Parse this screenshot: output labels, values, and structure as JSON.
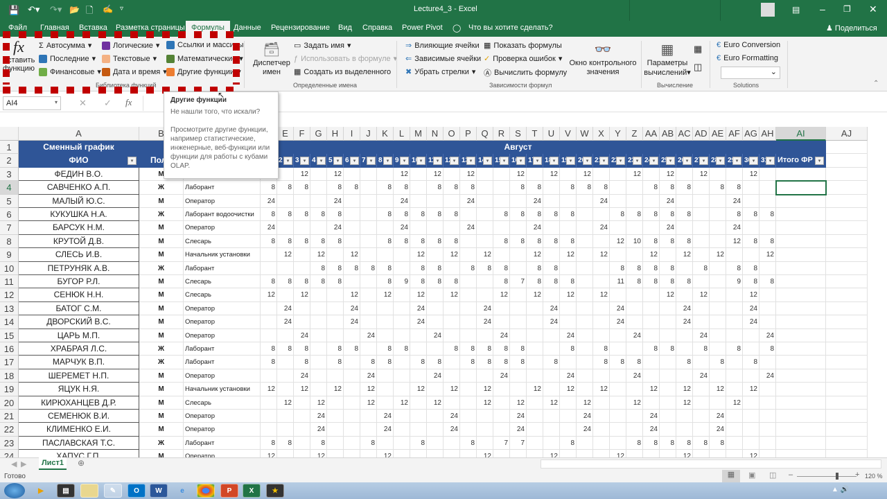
{
  "window": {
    "title": "Lecture4_3  -  Excel",
    "share": "Поделиться",
    "tell_me": "Что вы хотите сделать?"
  },
  "tabs": [
    "Файл",
    "Главная",
    "Вставка",
    "Разметка страницы",
    "Формулы",
    "Данные",
    "Рецензирование",
    "Вид",
    "Справка",
    "Power Pivot"
  ],
  "active_tab": "Формулы",
  "ribbon": {
    "insert_function": [
      "Вставить",
      "функцию"
    ],
    "library": {
      "items": [
        "Автосумма",
        "Последние",
        "Финансовые",
        "Логические",
        "Текстовые",
        "Дата и время",
        "Ссылки и массивы",
        "Математические",
        "Другие функции"
      ],
      "label": "Библиотека функций"
    },
    "names": {
      "manager": [
        "Диспетчер",
        "имен"
      ],
      "define": "Задать имя",
      "use": "Использовать в формуле",
      "create": "Создать из выделенного",
      "label": "Определенные имена"
    },
    "audit": {
      "items": [
        "Влияющие ячейки",
        "Зависимые ячейки",
        "Убрать стрелки",
        "Показать формулы",
        "Проверка ошибок",
        "Вычислить формулу"
      ],
      "label": "Зависимости формул"
    },
    "watch": [
      "Окно контрольного",
      "значения"
    ],
    "calc": {
      "options": [
        "Параметры",
        "вычислений"
      ],
      "label": "Вычисление"
    },
    "solutions": {
      "items": [
        "Euro Conversion",
        "Euro Formatting"
      ],
      "label": "Solutions"
    }
  },
  "tooltip": {
    "title": "Другие функции",
    "subtitle": "Не нашли того, что искали?",
    "body": "Просмотрите другие функции, например статистические, инженерные, веб-функции или функции для работы с кубами OLAP."
  },
  "namebox": "AI4",
  "columns": [
    "A",
    "B",
    "C",
    "D",
    "E",
    "F",
    "G",
    "H",
    "I",
    "J",
    "K",
    "L",
    "M",
    "N",
    "O",
    "P",
    "Q",
    "R",
    "S",
    "T",
    "U",
    "V",
    "W",
    "X",
    "Y",
    "Z",
    "AA",
    "AB",
    "AC",
    "AD",
    "AE",
    "AF",
    "AG",
    "AH",
    "AI",
    "AJ"
  ],
  "sheet": {
    "title": "Сменный график",
    "month": "Август",
    "h_name": "ФИО",
    "h_gender": "Пол",
    "h_total": "Итого ФР",
    "days": [
      "1",
      "2",
      "3",
      "4",
      "5",
      "6",
      "7",
      "8",
      "9",
      "10",
      "11",
      "12",
      "13",
      "14",
      "15",
      "16",
      "17",
      "18",
      "19",
      "20",
      "21",
      "22",
      "23",
      "24",
      "25",
      "26",
      "27",
      "28",
      "29",
      "30",
      "31"
    ],
    "selected": "AI4",
    "rows": [
      {
        "n": "ФЕДИН В.О.",
        "g": "М",
        "p": "Начальник установки",
        "h": {
          "D": 12,
          "F": 12,
          "H": 12,
          "L": 12,
          "N": 12,
          "P": 12,
          "S": 12,
          "U": 12,
          "W": 12,
          "Z": 12,
          "AB": 12,
          "AD": 12,
          "AG": 12
        }
      },
      {
        "n": "САВЧЕНКО А.П.",
        "g": "Ж",
        "p": "Лаборант",
        "h": {
          "D": 8,
          "E": 8,
          "F": 8,
          "H": 8,
          "I": 8,
          "K": 8,
          "L": 8,
          "N": 8,
          "O": 8,
          "P": 8,
          "S": 8,
          "T": 8,
          "V": 8,
          "W": 8,
          "X": 8,
          "AA": 8,
          "AB": 8,
          "AC": 8,
          "AE": 8,
          "AF": 8
        }
      },
      {
        "n": "МАЛЫЙ Ю.С.",
        "g": "М",
        "p": "Оператор",
        "h": {
          "D": 24,
          "H": 24,
          "L": 24,
          "P": 24,
          "T": 24,
          "X": 24,
          "AB": 24,
          "AF": 24
        }
      },
      {
        "n": "КУКУШКА Н.А.",
        "g": "Ж",
        "p": "Лаборант водоочистки",
        "h": {
          "D": 8,
          "E": 8,
          "F": 8,
          "G": 8,
          "H": 8,
          "K": 8,
          "L": 8,
          "M": 8,
          "N": 8,
          "O": 8,
          "R": 8,
          "S": 8,
          "T": 8,
          "U": 8,
          "V": 8,
          "Y": 8,
          "Z": 8,
          "AA": 8,
          "AB": 8,
          "AC": 8,
          "AF": 8,
          "AG": 8,
          "AH": 8
        }
      },
      {
        "n": "БАРСУК Н.М.",
        "g": "М",
        "p": "Оператор",
        "h": {
          "D": 24,
          "H": 24,
          "L": 24,
          "P": 24,
          "T": 24,
          "X": 24,
          "AB": 24,
          "AF": 24
        }
      },
      {
        "n": "КРУТОЙ Д.В.",
        "g": "М",
        "p": "Слесарь",
        "h": {
          "D": 8,
          "E": 8,
          "F": 8,
          "G": 8,
          "H": 8,
          "K": 8,
          "L": 8,
          "M": 8,
          "N": 8,
          "O": 8,
          "R": 8,
          "S": 8,
          "T": 8,
          "U": 8,
          "V": 8,
          "Y": 12,
          "Z": 10,
          "AA": 8,
          "AB": 8,
          "AC": 8,
          "AF": 12,
          "AG": 8,
          "AH": 8
        }
      },
      {
        "n": "СЛЕСЬ И.В.",
        "g": "М",
        "p": "Начальник установки",
        "h": {
          "E": 12,
          "G": 12,
          "I": 12,
          "M": 12,
          "O": 12,
          "Q": 12,
          "T": 12,
          "V": 12,
          "X": 12,
          "AA": 12,
          "AC": 12,
          "AE": 12,
          "AH": 12
        }
      },
      {
        "n": "ПЕТРУНЯК А.В.",
        "g": "Ж",
        "p": "Лаборант",
        "h": {
          "G": 8,
          "H": 8,
          "I": 8,
          "J": 8,
          "K": 8,
          "M": 8,
          "N": 8,
          "P": 8,
          "Q": 8,
          "R": 8,
          "T": 8,
          "U": 8,
          "Y": 8,
          "Z": 8,
          "AA": 8,
          "AB": 8,
          "AD": 8,
          "AF": 8,
          "AG": 8
        }
      },
      {
        "n": "БУГОР Р.Л.",
        "g": "М",
        "p": "Слесарь",
        "h": {
          "D": 8,
          "E": 8,
          "F": 8,
          "G": 8,
          "H": 8,
          "K": 8,
          "L": 9,
          "M": 8,
          "N": 8,
          "O": 8,
          "R": 8,
          "S": 7,
          "T": 8,
          "U": 8,
          "V": 8,
          "Y": 11,
          "Z": 8,
          "AA": 8,
          "AB": 8,
          "AC": 8,
          "AF": 9,
          "AG": 8,
          "AH": 8
        }
      },
      {
        "n": "СЕНЮК Н.Н.",
        "g": "М",
        "p": "Слесарь",
        "h": {
          "D": 12,
          "F": 12,
          "I": 12,
          "K": 12,
          "M": 12,
          "O": 12,
          "R": 12,
          "T": 12,
          "V": 12,
          "X": 12,
          "AB": 12,
          "AD": 12,
          "AG": 12
        }
      },
      {
        "n": "БАТОГ С.М.",
        "g": "М",
        "p": "Оператор",
        "h": {
          "E": 24,
          "I": 24,
          "M": 24,
          "Q": 24,
          "U": 24,
          "Y": 24,
          "AC": 24,
          "AG": 24
        }
      },
      {
        "n": "ДВОРСКИЙ В.С.",
        "g": "М",
        "p": "Оператор",
        "h": {
          "E": 24,
          "I": 24,
          "M": 24,
          "Q": 24,
          "U": 24,
          "Y": 24,
          "AC": 24,
          "AG": 24
        }
      },
      {
        "n": "ЦАРЬ М.П.",
        "g": "М",
        "p": "Оператор",
        "h": {
          "F": 24,
          "J": 24,
          "N": 24,
          "R": 24,
          "V": 24,
          "Z": 24,
          "AD": 24,
          "AH": 24
        }
      },
      {
        "n": "ХРАБРАЯ Л.С.",
        "g": "Ж",
        "p": "Лаборант",
        "h": {
          "D": 8,
          "E": 8,
          "F": 8,
          "H": 8,
          "I": 8,
          "K": 8,
          "L": 8,
          "O": 8,
          "P": 8,
          "Q": 8,
          "R": 8,
          "S": 8,
          "V": 8,
          "X": 8,
          "AA": 8,
          "AB": 8,
          "AD": 8,
          "AF": 8,
          "AH": 8
        }
      },
      {
        "n": "МАРЧУК В.П.",
        "g": "Ж",
        "p": "Лаборант",
        "h": {
          "D": 8,
          "F": 8,
          "H": 8,
          "J": 8,
          "K": 8,
          "M": 8,
          "N": 8,
          "P": 8,
          "Q": 8,
          "R": 8,
          "S": 8,
          "U": 8,
          "X": 8,
          "Y": 8,
          "Z": 8,
          "AC": 8,
          "AE": 8,
          "AG": 8
        }
      },
      {
        "n": "ШЕРЕМЕТ Н.П.",
        "g": "М",
        "p": "Оператор",
        "h": {
          "F": 24,
          "J": 24,
          "N": 24,
          "R": 24,
          "V": 24,
          "Z": 24,
          "AD": 24,
          "AH": 24
        }
      },
      {
        "n": "ЯЦУК Н.Я.",
        "g": "М",
        "p": "Начальник установки",
        "h": {
          "D": 12,
          "F": 12,
          "H": 12,
          "J": 12,
          "M": 12,
          "O": 12,
          "Q": 12,
          "T": 12,
          "V": 12,
          "X": 12,
          "AA": 12,
          "AC": 12,
          "AE": 12,
          "AG": 12
        }
      },
      {
        "n": "КИРЮХАНЦЕВ Д.Р.",
        "g": "М",
        "p": "Слесарь",
        "h": {
          "E": 12,
          "G": 12,
          "J": 12,
          "L": 12,
          "N": 12,
          "Q": 12,
          "S": 12,
          "U": 12,
          "W": 12,
          "Z": 12,
          "AC": 12,
          "AF": 12
        }
      },
      {
        "n": "СЕМЕНЮК В.И.",
        "g": "М",
        "p": "Оператор",
        "h": {
          "G": 24,
          "K": 24,
          "O": 24,
          "S": 24,
          "W": 24,
          "AA": 24,
          "AE": 24
        }
      },
      {
        "n": "КЛИМЕНКО Е.И.",
        "g": "М",
        "p": "Оператор",
        "h": {
          "G": 24,
          "K": 24,
          "O": 24,
          "S": 24,
          "W": 24,
          "AA": 24,
          "AE": 24
        }
      },
      {
        "n": "ПАСЛАВСКАЯ Т.С.",
        "g": "Ж",
        "p": "Лаборант",
        "h": {
          "D": 8,
          "E": 8,
          "G": 8,
          "J": 8,
          "M": 8,
          "P": 8,
          "R": 7,
          "S": 7,
          "V": 8,
          "Z": 8,
          "AA": 8,
          "AB": 8,
          "AC": 8,
          "AD": 8,
          "AE": 8
        }
      },
      {
        "n": "ХАПУС Г.П.",
        "g": "М",
        "p": "Оператор",
        "h": {
          "D": 12,
          "G": 12,
          "K": 12,
          "Q": 12,
          "U": 12,
          "Y": 12,
          "AC": 12,
          "AG": 12
        }
      }
    ]
  },
  "sheet_tab": "Лист1",
  "status": {
    "ready": "Готово",
    "zoom": "120 %",
    "zoom_level": 120
  },
  "taskbar": [
    "start",
    "media-player",
    "video",
    "explorer",
    "paint",
    "outlook",
    "word",
    "internet-explorer",
    "chrome",
    "powerpoint",
    "excel",
    "app"
  ],
  "colors": {
    "excel_green": "#217346",
    "header_blue": "#2f5597",
    "highlight_red": "#c00000"
  }
}
